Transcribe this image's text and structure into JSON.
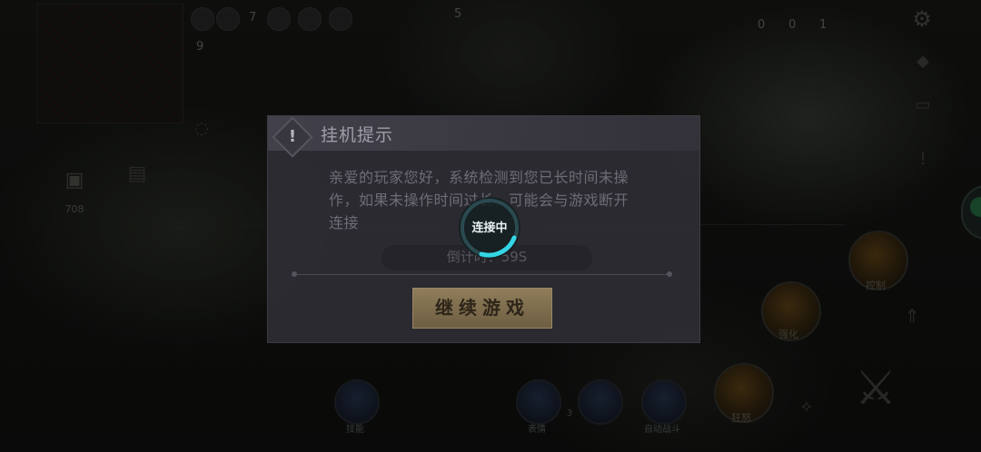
{
  "hud": {
    "top_values": [
      "7",
      "5"
    ],
    "right_values": [
      "0",
      "0",
      "1"
    ],
    "level": "9",
    "bag_count": "708"
  },
  "skills": [
    {
      "label": "控制"
    },
    {
      "label": "强化"
    },
    {
      "label": "狂怒"
    }
  ],
  "bottom_bar": [
    {
      "label": "技能"
    },
    {
      "label": "表情"
    },
    {
      "label": "3"
    },
    {
      "label": "自动战斗"
    }
  ],
  "idle_dialog": {
    "title": "挂机提示",
    "message": "亲爱的玩家您好，系统检测到您已长时间未操作，如果未操作时间过长，可能会与游戏断开连接",
    "countdown": "倒计时：59S",
    "continue_label": "继续游戏"
  },
  "connection": {
    "status": "连接中",
    "accent": "#34d6e6"
  },
  "colors": {
    "dialog_bg": "#2e2d34",
    "button_gold": "#8f7d5a",
    "title_text": "#a09ea8"
  }
}
